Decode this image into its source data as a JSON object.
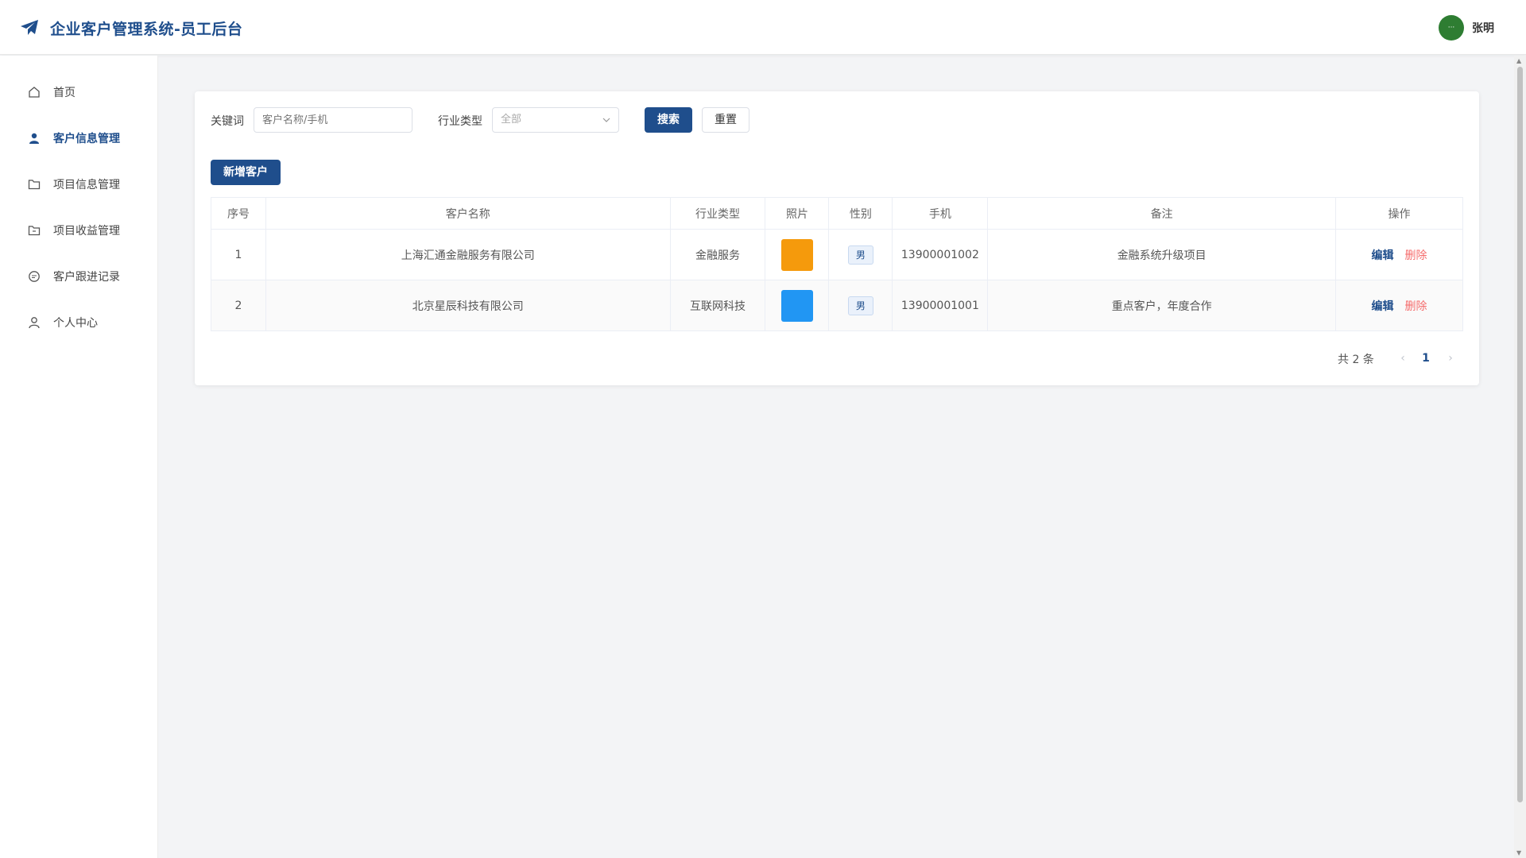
{
  "header": {
    "title": "企业客户管理系统-员工后台",
    "avatar_text": "···",
    "user_name": "张明"
  },
  "sidebar": {
    "items": [
      {
        "label": "首页",
        "icon": "home-icon",
        "active": false
      },
      {
        "label": "客户信息管理",
        "icon": "user-icon",
        "active": true
      },
      {
        "label": "项目信息管理",
        "icon": "folder-icon",
        "active": false
      },
      {
        "label": "项目收益管理",
        "icon": "folder-money-icon",
        "active": false
      },
      {
        "label": "客户跟进记录",
        "icon": "chat-icon",
        "active": false
      },
      {
        "label": "个人中心",
        "icon": "person-icon",
        "active": false
      }
    ]
  },
  "filters": {
    "keyword_label": "关键词",
    "keyword_placeholder": "客户名称/手机",
    "keyword_value": "",
    "industry_label": "行业类型",
    "industry_value": "全部",
    "search_label": "搜索",
    "reset_label": "重置",
    "add_label": "新增客户"
  },
  "table": {
    "columns": [
      "序号",
      "客户名称",
      "行业类型",
      "照片",
      "性别",
      "手机",
      "备注",
      "操作"
    ],
    "rows": [
      {
        "index": "1",
        "name": "上海汇通金融服务有限公司",
        "industry": "金融服务",
        "photo_color": "#f59a0c",
        "gender": "男",
        "phone": "13900001002",
        "note": "金融系统升级项目",
        "edit": "编辑",
        "delete": "删除"
      },
      {
        "index": "2",
        "name": "北京星辰科技有限公司",
        "industry": "互联网科技",
        "photo_color": "#2196f3",
        "gender": "男",
        "phone": "13900001001",
        "note": "重点客户，年度合作",
        "edit": "编辑",
        "delete": "删除"
      }
    ]
  },
  "pagination": {
    "total_text": "共 2 条",
    "current_page": "1",
    "prev_icon": "chevron-left-icon",
    "next_icon": "chevron-right-icon"
  },
  "colors": {
    "brand": "#1f4e8c",
    "danger": "#f56c6c",
    "avatar_bg": "#2e7d32"
  }
}
